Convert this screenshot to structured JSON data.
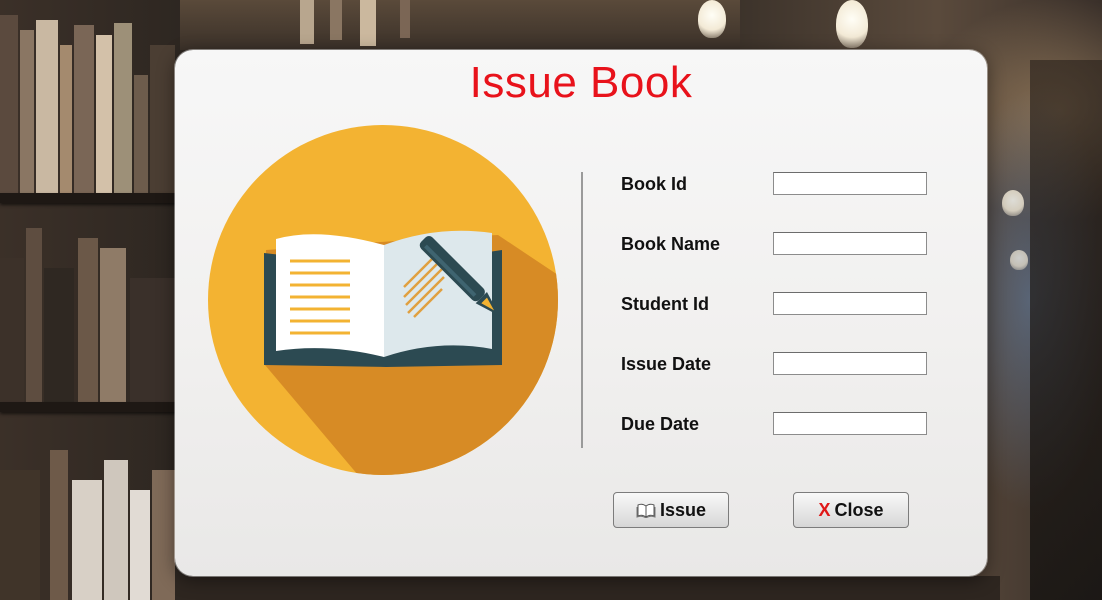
{
  "dialog": {
    "title": "Issue Book",
    "fields": [
      {
        "label": "Book Id",
        "value": ""
      },
      {
        "label": "Book Name",
        "value": ""
      },
      {
        "label": "Student Id",
        "value": ""
      },
      {
        "label": "Issue Date",
        "value": ""
      },
      {
        "label": "Due Date",
        "value": ""
      }
    ],
    "buttons": {
      "issue_label": "Issue",
      "close_label": "Close",
      "close_glyph": "X"
    }
  },
  "icons": {
    "logo": "open-book-pen-icon",
    "issue": "book-icon",
    "close": "close-icon"
  },
  "colors": {
    "title": "#e8121b",
    "logo_circle": "#f3b332",
    "logo_shadow": "#d78b25",
    "book_dark": "#2c4a52",
    "close_icon": "#e01818"
  }
}
